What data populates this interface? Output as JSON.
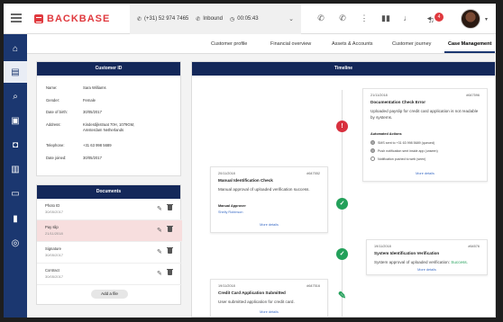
{
  "app": {
    "name": "BACKBASE"
  },
  "callbar": {
    "phone": "(+31) 52 974 7465",
    "direction": "Inbound",
    "timer": "00:05:43"
  },
  "notifications": {
    "count": "4"
  },
  "tabs": [
    "Customer profile",
    "Financial overview",
    "Assets & Accounts",
    "Customer journey",
    "Case Management"
  ],
  "customer": {
    "header": "Customer ID",
    "fields": [
      {
        "k": "Name:",
        "v": "Sara Williams"
      },
      {
        "k": "Gender:",
        "v": "Female"
      },
      {
        "k": "Date of birth:",
        "v": "30/05/2017"
      },
      {
        "k": "Address:",
        "v": "Kinderdijkstraat 70H, 1079GM, Amsterdam Netherlands"
      },
      {
        "k": "Telephone:",
        "v": "+31 63 998 5689"
      },
      {
        "k": "Date joined:",
        "v": "30/05/2017"
      }
    ]
  },
  "documents": {
    "header": "Documents",
    "items": [
      {
        "title": "Photo ID",
        "date": "30/05/2017"
      },
      {
        "title": "Pay slip",
        "date": "21/11/2018"
      },
      {
        "title": "Signature",
        "date": "30/05/2017"
      },
      {
        "title": "Contract",
        "date": "30/05/2017"
      }
    ],
    "add_label": "Add a file"
  },
  "timeline": {
    "header": "Timeline",
    "cards": [
      {
        "date": "21/11/2018",
        "id": "#647596",
        "title": "Documentation Check Error",
        "desc": "Uploaded payslip for credit card application is not readable by systems.",
        "sub_label": "Automated Actions",
        "actions": [
          "SMS sent to +31 63 998 5689 (queued)",
          "Push notification sent inside app (unseen)",
          "Notification pushed to web (seen)"
        ],
        "more": "More details"
      },
      {
        "date": "20/11/2018",
        "id": "#647552",
        "title": "Manual Identification Check",
        "desc": "Manual approval of uploaded verification success.",
        "sub_label": "Manual Approver",
        "sub_value": "Shelly Robinson",
        "more": "More details"
      },
      {
        "date": "19/11/2018",
        "id": "#64576",
        "title": "System Identification Verification",
        "desc_prefix": "System approval of uploaded verification: ",
        "desc_status": "Success.",
        "more": "More details"
      },
      {
        "date": "19/11/2018",
        "id": "#647516",
        "title": "Credit Card Application Submitted",
        "desc": "User submitted application for credit card.",
        "more": "More details"
      }
    ]
  },
  "colors": {
    "navy": "#1b3770",
    "accent_red": "#e0393e",
    "success_green": "#23a05a"
  }
}
